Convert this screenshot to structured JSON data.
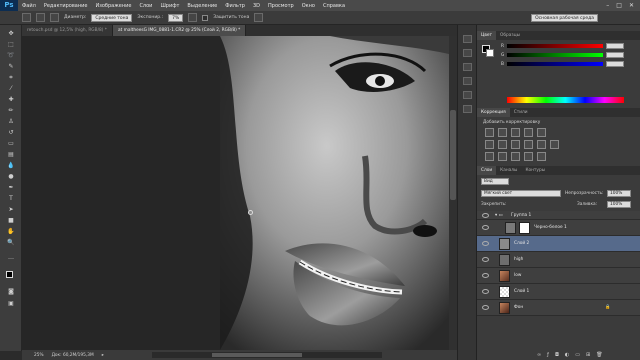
{
  "app": {
    "logo": "Ps"
  },
  "menu": [
    "Файл",
    "Редактирование",
    "Изображение",
    "Слои",
    "Шрифт",
    "Выделение",
    "Фильтр",
    "3D",
    "Просмотр",
    "Окно",
    "Справка"
  ],
  "options": {
    "feather_label": "Диаметр:",
    "mode_value": "Средние тона",
    "exposure_label": "Экспонир.:",
    "exposure_value": "7%",
    "protect_label": "Защитить тона",
    "workspace": "Основная рабочая среда"
  },
  "tabs": [
    {
      "label": "retouch.psd @ 12,5% (high, RGB/8) *",
      "active": false
    },
    {
      "label": "at maltheesG IMG_0881-1.CR2 @ 25% (Слой 2, RGB/8) *",
      "active": true
    }
  ],
  "status": {
    "zoom": "25%",
    "doc": "Док: 60,2M/195,3M"
  },
  "color_panel": {
    "tabs": [
      "Цвет",
      "Образцы"
    ],
    "channels": [
      "R",
      "G",
      "B"
    ]
  },
  "adjustments_panel": {
    "tabs": [
      "Коррекция",
      "Стили"
    ],
    "title": "Добавить корректировку"
  },
  "layers_panel": {
    "tabs": [
      "Слои",
      "Каналы",
      "Контуры"
    ],
    "kind_label": "Вид",
    "blend_mode": "Мягкий свет",
    "opacity_label": "Непрозрачность:",
    "opacity_value": "100%",
    "lock_label": "Закрепить:",
    "fill_label": "Заливка:",
    "fill_value": "100%",
    "group_name": "Группа 1",
    "layers": [
      {
        "name": "Черно-белое 1",
        "type": "adjustment",
        "selected": false
      },
      {
        "name": "Слой 2",
        "type": "gray",
        "selected": true
      },
      {
        "name": "high",
        "type": "gray",
        "selected": false
      },
      {
        "name": "low",
        "type": "photo",
        "selected": false
      },
      {
        "name": "Слой 1",
        "type": "transparent",
        "selected": false
      },
      {
        "name": "Фон",
        "type": "photo",
        "selected": false
      }
    ]
  },
  "colors": {
    "selection": "#566a8b",
    "brand_bg": "#0c2d52",
    "brand_fg": "#4fb6f4"
  }
}
